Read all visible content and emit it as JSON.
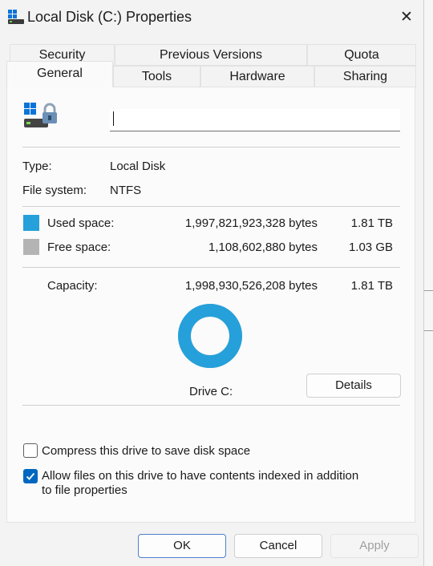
{
  "window": {
    "title": "Local Disk (C:) Properties",
    "close_glyph": "✕"
  },
  "tabs": {
    "row1": [
      "Security",
      "Previous Versions",
      "Quota"
    ],
    "row2": [
      "General",
      "Tools",
      "Hardware",
      "Sharing"
    ],
    "active": "General"
  },
  "general": {
    "name_value": "",
    "type_label": "Type:",
    "type_value": "Local Disk",
    "fs_label": "File system:",
    "fs_value": "NTFS",
    "used": {
      "label": "Used space:",
      "bytes": "1,997,821,923,328 bytes",
      "size": "1.81 TB",
      "color": "#26a0da"
    },
    "free": {
      "label": "Free space:",
      "bytes": "1,108,602,880 bytes",
      "size": "1.03 GB",
      "color": "#b4b4b4"
    },
    "capacity": {
      "label": "Capacity:",
      "bytes": "1,998,930,526,208 bytes",
      "size": "1.81 TB"
    },
    "used_fraction": 0.9994,
    "drive_label": "Drive C:",
    "details_label": "Details",
    "compress": {
      "label": "Compress this drive to save disk space",
      "checked": false
    },
    "index": {
      "label_line1": "Allow files on this drive to have contents indexed in addition",
      "label_line2": "to file properties",
      "checked": true
    }
  },
  "buttons": {
    "ok": "OK",
    "cancel": "Cancel",
    "apply": "Apply"
  },
  "colors": {
    "accent": "#0067c0",
    "used": "#26a0da",
    "free": "#b4b4b4"
  }
}
